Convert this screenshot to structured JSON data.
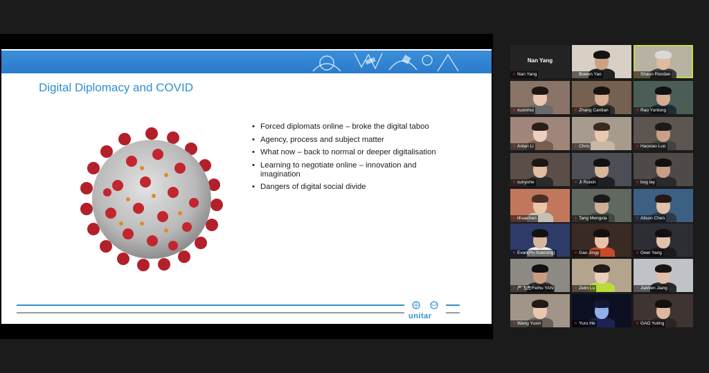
{
  "slide": {
    "title": "Digital Diplomacy and COVID",
    "bullets": [
      "Forced diplomats online – broke the digital taboo",
      "Agency, process and subject matter",
      "What now – back to normal or deeper digitalisation",
      "Learning to negotiate online – innovation and imagination",
      "Dangers of digital social divide"
    ],
    "logo_text": "unitar"
  },
  "participants": [
    {
      "name": "Nan Yang",
      "display": "Nan Yang",
      "bg": "#232323",
      "no_video": true
    },
    {
      "name": "Bowen Yao",
      "bg": "#d8d0c4",
      "skin": "#caa283",
      "hair": "#141414",
      "shirt": "#222"
    },
    {
      "name": "Shaun Riordan",
      "bg": "#b8b2a2",
      "skin": "#e0b9a0",
      "hair": "#d9d9d9",
      "shirt": "#3a3a3a",
      "active": true
    },
    {
      "name": "xuxinhui",
      "bg": "#8a7468",
      "skin": "#e7c7b2",
      "hair": "#1c1512",
      "shirt": "#6a6a6a"
    },
    {
      "name": "Zhang Cantian",
      "bg": "#76604f",
      "skin": "#d7b096",
      "hair": "#161210",
      "shirt": "#2d2d2d"
    },
    {
      "name": "Rao Yunlong",
      "bg": "#4b5d57",
      "skin": "#d4ad92",
      "hair": "#111",
      "shirt": "#1f2b35"
    },
    {
      "name": "Anlan Li",
      "bg": "#9f857a",
      "skin": "#ecd0c0",
      "hair": "#2c1e18",
      "shirt": "#7a5d50"
    },
    {
      "name": "Chris",
      "bg": "#a79b8e",
      "skin": "#e9c9b0",
      "hair": "#3a2a22",
      "shirt": "#c9b7a6"
    },
    {
      "name": "Haoxiao Luo",
      "bg": "#5d5650",
      "skin": "#caa089",
      "hair": "#1b1b1b",
      "shirt": "#424242"
    },
    {
      "name": "sunyuhe",
      "bg": "#5b4e49",
      "skin": "#e3bca5",
      "hair": "#1b1614",
      "shirt": "#2b2b2b"
    },
    {
      "name": "Ji Ruixin",
      "bg": "#4b4f55",
      "skin": "#d9b69c",
      "hair": "#111",
      "shirt": "#1d2026"
    },
    {
      "name": "bog lay",
      "bg": "#4f4a47",
      "skin": "#c89e86",
      "hair": "#101010",
      "shirt": "#2a2a2a"
    },
    {
      "name": "lihuachen",
      "bg": "#c1775c",
      "skin": "#eac5ac",
      "hair": "#4a2f24",
      "shirt": "#c5c0b6"
    },
    {
      "name": "Tang Mengxia",
      "bg": "#606860",
      "skin": "#cfae97",
      "hair": "#1a1a1a",
      "shirt": "#414841"
    },
    {
      "name": "Alison Chen",
      "bg": "#3d5f83",
      "skin": "#e3c0a8",
      "hair": "#231815",
      "shirt": "#2e3a4a"
    },
    {
      "name": "Evan(Pu Xuecong)",
      "bg": "#2e3b68",
      "skin": "#d9b49c",
      "hair": "#111",
      "shirt": "#f0f0f0"
    },
    {
      "name": "Gao Jingy",
      "bg": "#3a2a24",
      "skin": "#e8c3aa",
      "hair": "#140f0d",
      "shirt": "#c84a2a"
    },
    {
      "name": "Geer Yang",
      "bg": "#2d2d34",
      "skin": "#e2c1ab",
      "hair": "#0f0f12",
      "shirt": "#1a1a1f"
    },
    {
      "name": "严飞虎/Feihu YAN",
      "bg": "#8c8a83",
      "skin": "#c99c82",
      "hair": "#101010",
      "shirt": "#2a2a2e"
    },
    {
      "name": "Zelin Lu",
      "bg": "#b4a48e",
      "skin": "#ebcfbb",
      "hair": "#231c18",
      "shirt": "#b8dc3a"
    },
    {
      "name": "JiaWen Jiang",
      "bg": "#bfc3c7",
      "skin": "#e2bfa8",
      "hair": "#1a1512",
      "shirt": "#2a2a2a"
    },
    {
      "name": "Wang Yuxin",
      "bg": "#a19488",
      "skin": "#e9c8b2",
      "hair": "#211914",
      "shirt": "#6a5e56"
    },
    {
      "name": "Yuru He",
      "bg": "#0c0f22",
      "skin": "#8fb0e8",
      "hair": "#141730",
      "shirt": "#1d2350"
    },
    {
      "name": "GAO Yuting",
      "bg": "#3e3431",
      "skin": "#dcb8a0",
      "hair": "#140f0d",
      "shirt": "#2a2422"
    }
  ],
  "colors": {
    "accent": "#2f8fd0",
    "active_speaker": "#c5dc3a",
    "muted_mic": "#e03030"
  }
}
